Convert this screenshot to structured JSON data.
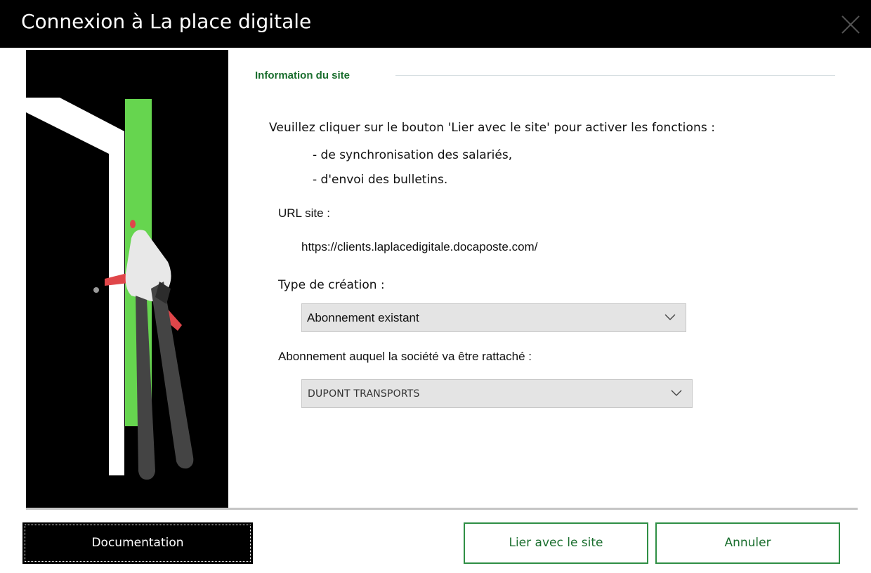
{
  "window": {
    "title": "Connexion à La place digitale",
    "close_icon": "close-icon"
  },
  "illustration": {
    "description_icon": "person-door-illustration",
    "colors": {
      "background": "#000000",
      "door_frame": "#ffffff",
      "opening": "#66d54f",
      "accent": "#e0464a",
      "figure": "#444444"
    }
  },
  "section": {
    "title": "Information du site"
  },
  "instructions": {
    "intro": "Veuillez cliquer sur le bouton 'Lier avec le site' pour activer les fonctions :",
    "bullets": [
      "- de synchronisation des salariés,",
      "- d'envoi des bulletins."
    ]
  },
  "url": {
    "label": "URL site :",
    "value": "https://clients.laplacedigitale.docaposte.com/"
  },
  "creation_type": {
    "label": "Type de création :",
    "selected": "Abonnement existant"
  },
  "subscription": {
    "label": "Abonnement auquel la société va être rattaché :",
    "selected": "DUPONT TRANSPORTS"
  },
  "buttons": {
    "documentation": "Documentation",
    "link": "Lier avec le site",
    "cancel": "Annuler"
  },
  "colors": {
    "accent_green": "#2f8f45",
    "title_green": "#1a6e2e",
    "titlebar": "#000000"
  }
}
